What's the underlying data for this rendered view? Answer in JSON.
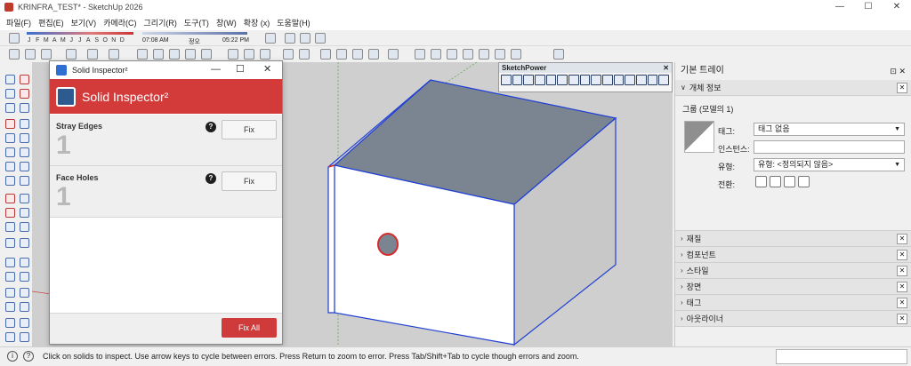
{
  "window": {
    "title": "KRINFRA_TEST* - SketchUp 2026",
    "minimize_glyph": "—",
    "maximize_glyph": "☐",
    "close_glyph": "✕"
  },
  "menu": {
    "items": [
      "파일(F)",
      "편집(E)",
      "보기(V)",
      "카메라(C)",
      "그리기(R)",
      "도구(T)",
      "창(W)",
      "확장 (x)",
      "도움말(H)"
    ]
  },
  "shadow_bar": {
    "months": [
      "J",
      "F",
      "M",
      "A",
      "M",
      "J",
      "J",
      "A",
      "S",
      "O",
      "N",
      "D"
    ],
    "time_start": "07:08 AM",
    "time_noon": "정오",
    "time_end": "05:22 PM"
  },
  "solid_inspector": {
    "window_title": "Solid Inspector²",
    "header_title": "Solid Inspector²",
    "minimize_glyph": "—",
    "maximize_glyph": "☐",
    "close_glyph": "✕",
    "sections": [
      {
        "label": "Stray Edges",
        "count": "1",
        "fix_label": "Fix"
      },
      {
        "label": "Face Holes",
        "count": "1",
        "fix_label": "Fix"
      }
    ],
    "help_glyph": "?",
    "fix_all_label": "Fix All",
    "accent_color": "#d33a3a"
  },
  "sketchpower": {
    "title": "SketchPower",
    "close_glyph": "✕"
  },
  "tray": {
    "title": "기본 트레이",
    "title_buttons": "⊡ ✕",
    "entity_info": {
      "header": "개체 정보",
      "group_name": "그룹 (모델의 1)",
      "tag_label": "태그:",
      "tag_value": "태그 없음",
      "instance_label": "인스턴스:",
      "instance_value": "",
      "type_label": "유형:",
      "type_value": "유형: <정의되지 않음>",
      "toggles_label": "전환:"
    },
    "panels": [
      "재질",
      "컴포넌트",
      "스타일",
      "장면",
      "태그",
      "아웃라이너"
    ],
    "expanded_chevron": "∨",
    "collapsed_chevron": "›",
    "close_glyph": "✕",
    "dropdown_glyph": "▼"
  },
  "status": {
    "message": "Click on solids to inspect. Use arrow keys to cycle between errors. Press Return to zoom to error. Press Tab/Shift+Tab to cycle though errors and zoom.",
    "info_glyph": "i",
    "help_glyph": "?"
  }
}
